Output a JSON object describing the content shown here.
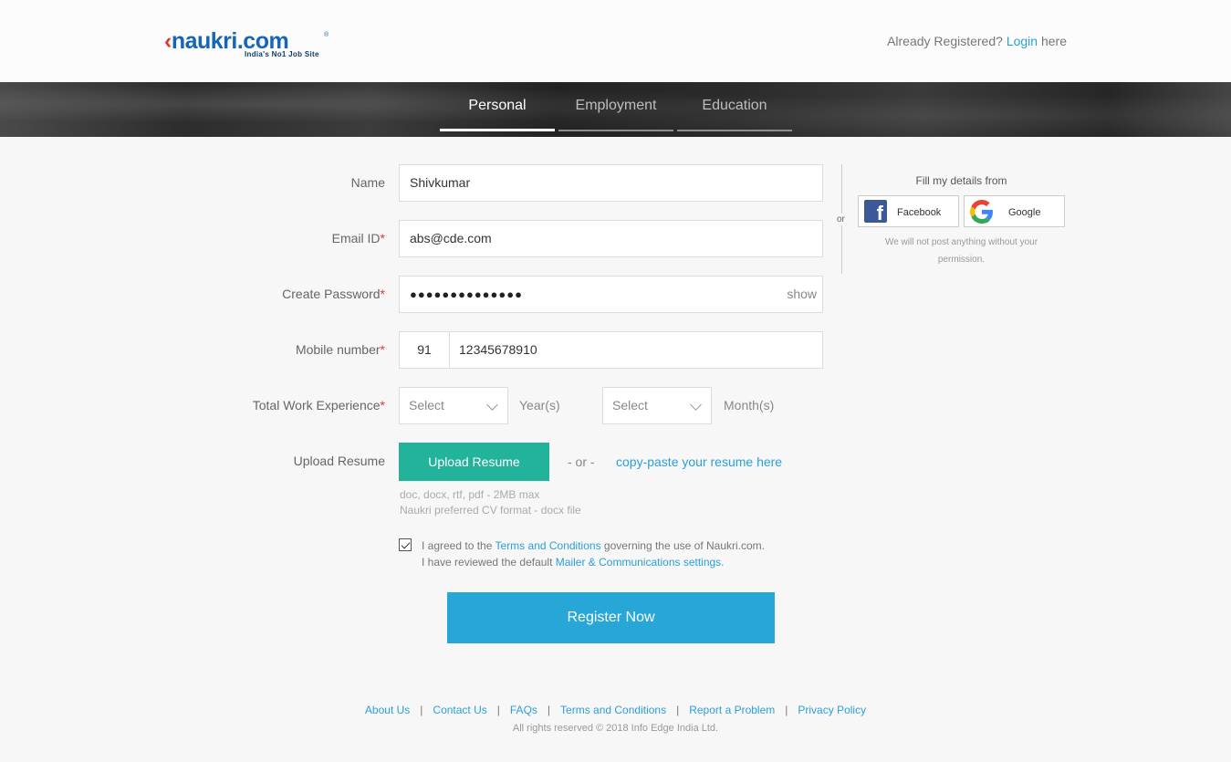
{
  "header": {
    "logo_text": "naukri.com",
    "logo_tagline": "India's No1 Job Site",
    "already_registered": "Already Registered?",
    "login_link": "Login",
    "login_suffix": "here"
  },
  "tabs": [
    {
      "label": "Personal",
      "active": true
    },
    {
      "label": "Employment",
      "active": false
    },
    {
      "label": "Education",
      "active": false
    }
  ],
  "form": {
    "name_label": "Name",
    "name_value": "Shivkumar",
    "email_label": "Email ID",
    "email_value": "abs@cde.com",
    "password_label": "Create Password",
    "password_mask": "●●●●●●●●●●●●●●",
    "password_show": "show",
    "mobile_label": "Mobile number",
    "country_code": "91",
    "mobile_value": "12345678910",
    "experience_label": "Total Work Experience",
    "years_select": "Select",
    "years_unit": "Year(s)",
    "months_select": "Select",
    "months_unit": "Month(s)",
    "resume_label": "Upload Resume",
    "upload_button": "Upload Resume",
    "or_text": "- or -",
    "paste_link": "copy-paste your resume here",
    "resume_hint_1": "doc, docx, rtf, pdf - 2MB max",
    "resume_hint_2": "Naukri preferred CV format - docx file",
    "required_mark": "*"
  },
  "agreement": {
    "checked": true,
    "line1_prefix": "I agreed to the",
    "terms_link": "Terms and Conditions",
    "line1_suffix": "governing the use of Naukri.com.",
    "line2_prefix": "I have reviewed the default",
    "mailer_link": "Mailer & Communications settings."
  },
  "register_button": "Register Now",
  "social": {
    "or": "or",
    "title": "Fill my details from",
    "facebook": "Facebook",
    "google": "Google",
    "disclaimer_1": "We will not post anything without your",
    "disclaimer_2": "permission."
  },
  "footer": {
    "links": [
      "About Us",
      "Contact Us",
      "FAQs",
      "Terms and Conditions",
      "Report a Problem",
      "Privacy Policy"
    ],
    "copyright": "All rights reserved © 2018 Info Edge India Ltd."
  },
  "colors": {
    "accent": "#2b9fd8",
    "upload_green": "#23b39b",
    "register_blue": "#27a6d8",
    "required_red": "#e33"
  }
}
